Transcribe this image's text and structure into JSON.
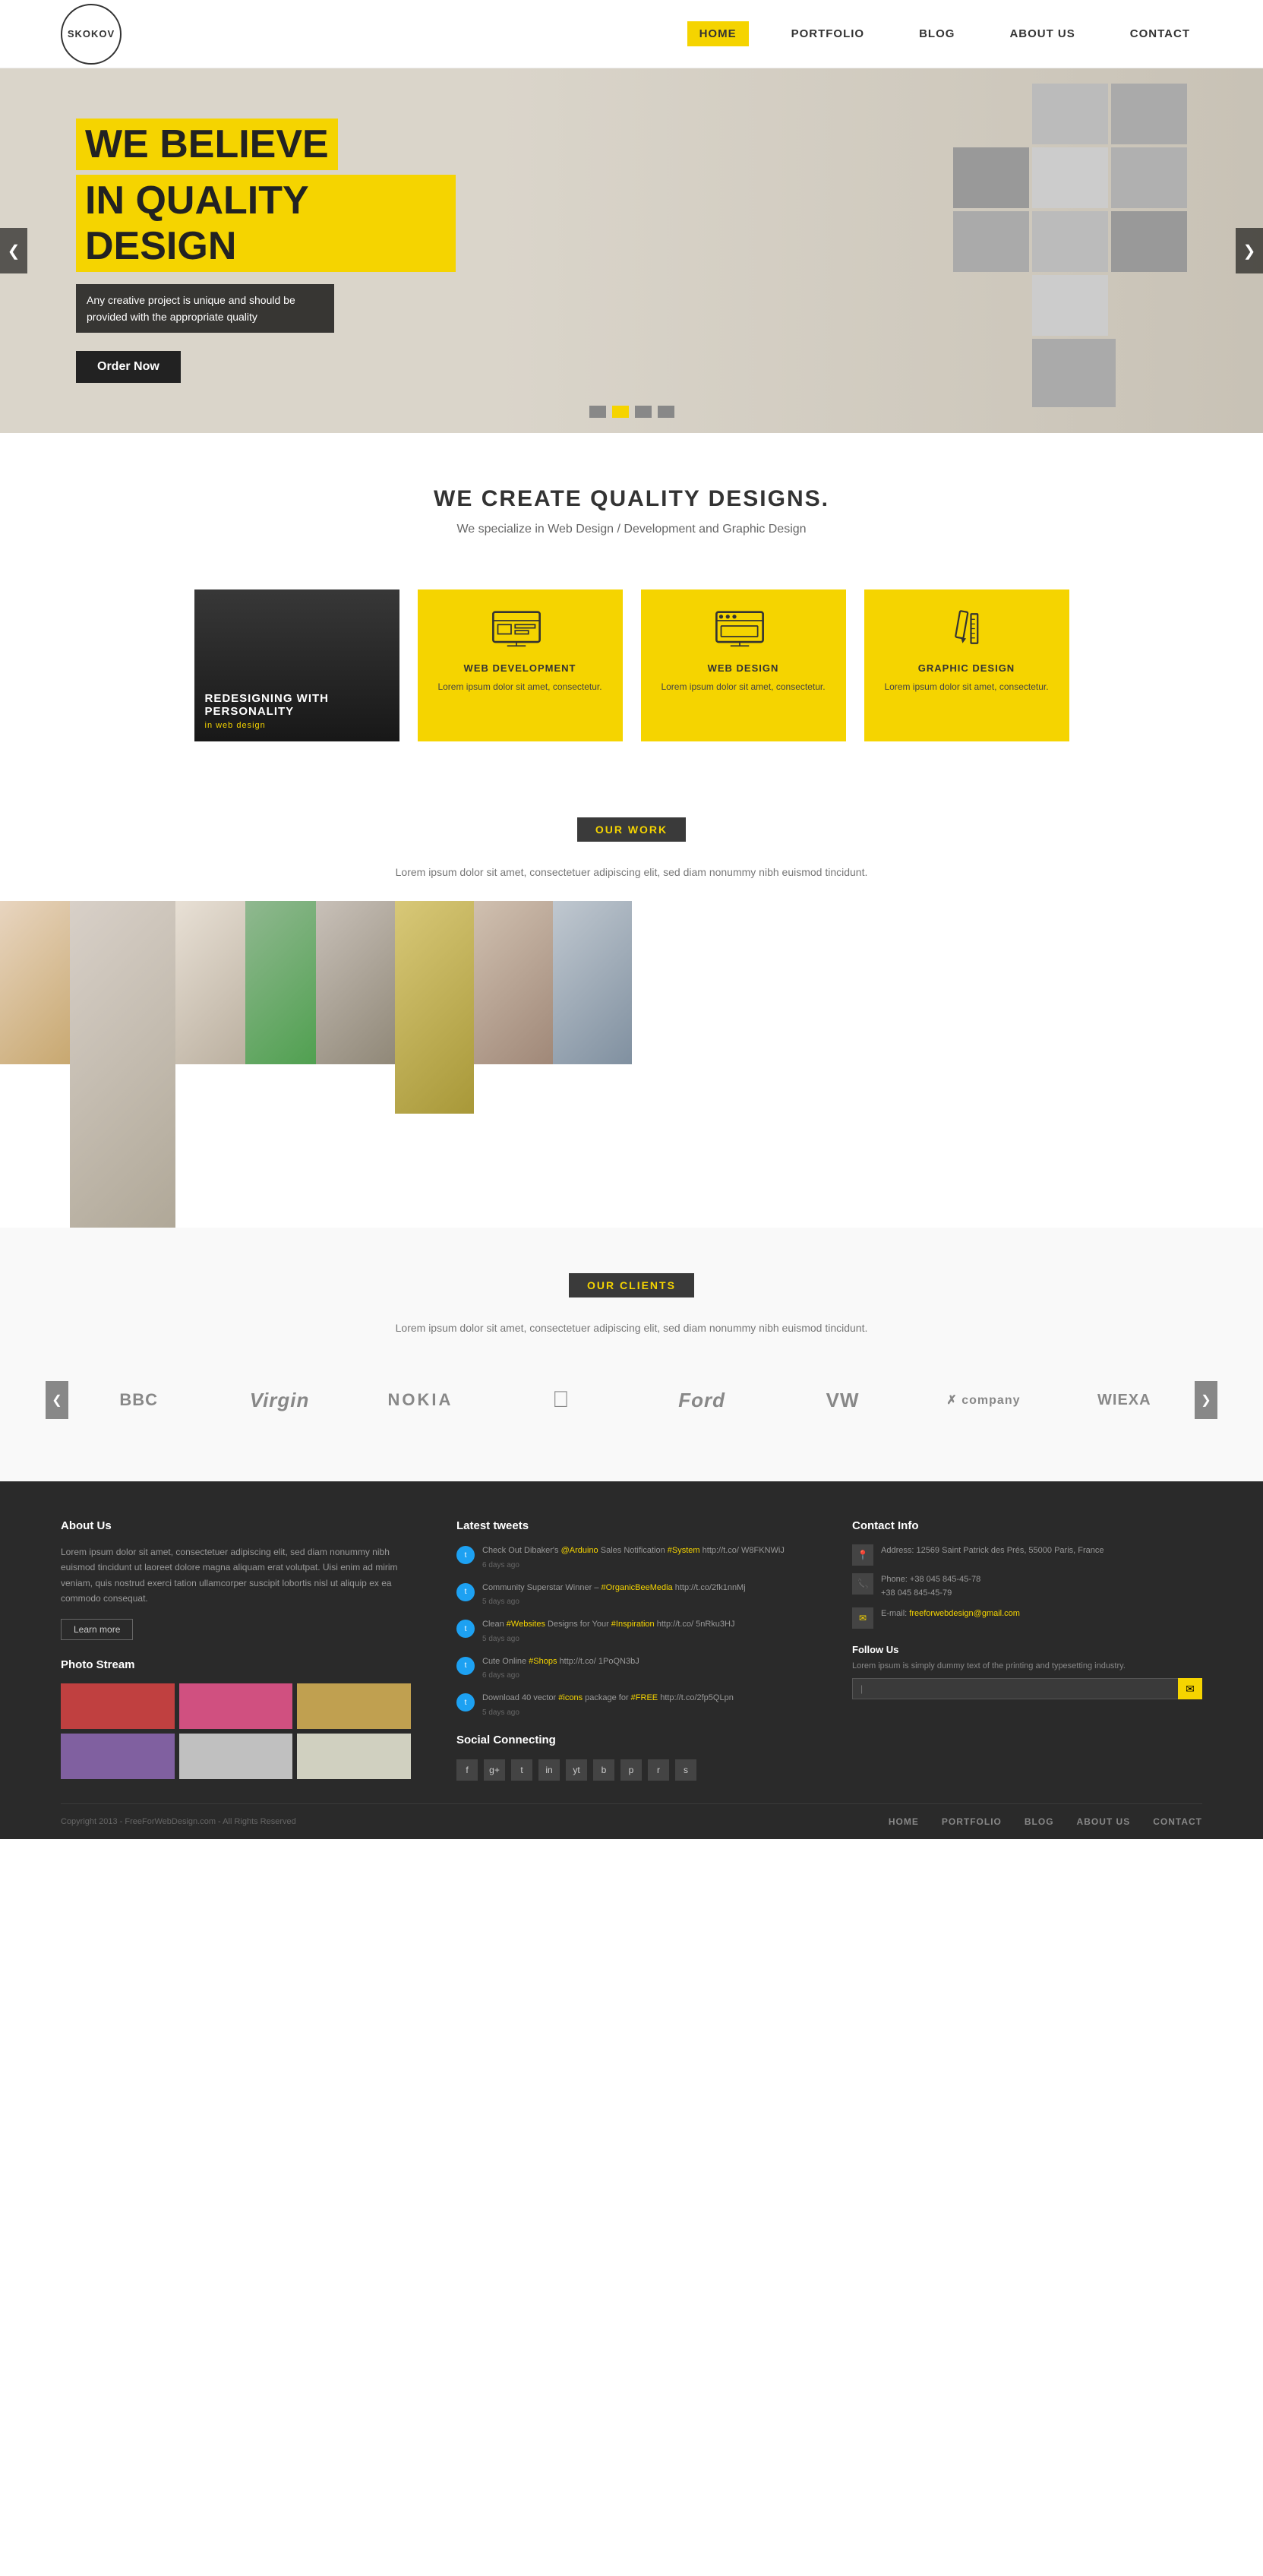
{
  "brand": {
    "name": "SKOKOV"
  },
  "nav": {
    "items": [
      {
        "label": "HOME",
        "active": true
      },
      {
        "label": "PORTFOLIO",
        "active": false
      },
      {
        "label": "BLOG",
        "active": false
      },
      {
        "label": "ABOUT US",
        "active": false
      },
      {
        "label": "CONTACT",
        "active": false
      }
    ]
  },
  "hero": {
    "title_line1": "WE BELIEVE",
    "title_line2": "IN QUALITY DESIGN",
    "subtitle": "Any creative project is unique and should be provided with the appropriate quality",
    "cta": "Order Now",
    "prev_arrow": "❮",
    "next_arrow": "❯"
  },
  "intro": {
    "title": "WE CREATE QUALITY DESIGNS.",
    "subtitle": "We specialize in Web Design / Development and Graphic Design"
  },
  "services": [
    {
      "type": "dark",
      "label": "REDESIGNING WITH PERSONALITY",
      "sublabel": "in web design"
    },
    {
      "type": "yellow",
      "name": "WEB DEVELOPMENT",
      "desc": "Lorem ipsum dolor sit amet, consectetur."
    },
    {
      "type": "yellow",
      "name": "WEB DESIGN",
      "desc": "Lorem ipsum dolor sit amet, consectetur."
    },
    {
      "type": "yellow",
      "name": "GRAPHIC DESIGN",
      "desc": "Lorem ipsum dolor sit amet, consectetur."
    }
  ],
  "our_work": {
    "label": "OUR WORK",
    "desc": "Lorem ipsum dolor sit amet, consectetuer adipiscing elit, sed diam nonummy nibh euismod tincidunt."
  },
  "our_clients": {
    "label": "OUR CLIENTS",
    "desc": "Lorem ipsum dolor sit amet, consectetuer adipiscing elit, sed diam nonummy nibh euismod tincidunt.",
    "logos": [
      "BBC",
      "Virgin",
      "NOKIA",
      "🍎",
      "Ford",
      "VW",
      "X company",
      "WIEXA"
    ],
    "prev": "❮",
    "next": "❯"
  },
  "footer": {
    "about_title": "About Us",
    "about_text": "Lorem ipsum dolor sit amet, consectetuer adipiscing elit, sed diam nonummy nibh euismod tincidunt ut laoreet dolore magna aliquam erat volutpat. Uisi enim ad mirim veniam, quis nostrud exerci tation ullamcorper suscipit lobortis nisl ut aliquip ex ea commodo consequat.",
    "learn_more": "Learn more",
    "photo_stream_title": "Photo Stream",
    "tweets_title": "Latest tweets",
    "tweets": [
      {
        "text": "Check Out Dibaker's @Arduino Sales Notification #System http://t.co/ W8FKNWiJ",
        "time": "6 days ago"
      },
      {
        "text": "Community Superstar Winner – #OrganicBeeMedia http://t.co/2fk1nnMj",
        "time": "5 days ago"
      },
      {
        "text": "Clean #Websites Designs for Your #Inspiration http://t.co/ 5nRku3HJ",
        "time": "5 days ago"
      },
      {
        "text": "Cute Online #Shops http://t.co/ 1PoQN3bJ",
        "time": "6 days ago"
      },
      {
        "text": "Download 40 vector #icons package for #FREE http://t.co/2fp5QLpn",
        "time": "5 days ago"
      }
    ],
    "social_label": "Social Connecting",
    "social_icons": [
      "f",
      "g+",
      "t",
      "in",
      "yt",
      "b",
      "p",
      "r",
      "s"
    ],
    "contact_title": "Contact Info",
    "address": "Address: 12569 Saint Patrick des Prés, 55000 Paris, France",
    "phone": "Phone: +38 045 845-45-78\n+38 045 845-45-79",
    "email": "E-mail: freeforwebdesign@gmail.com",
    "follow_title": "Follow Us",
    "follow_desc": "Lorem ipsum is simply dummy text of the printing and typesetting industry.",
    "email_placeholder": "|",
    "copy": "Copyright 2013 - FreeForWebDesign.com - All Rights Reserved",
    "footer_nav": [
      "HOME",
      "PORTFOLIO",
      "BLOG",
      "ABOUT US",
      "CONTACT"
    ]
  }
}
